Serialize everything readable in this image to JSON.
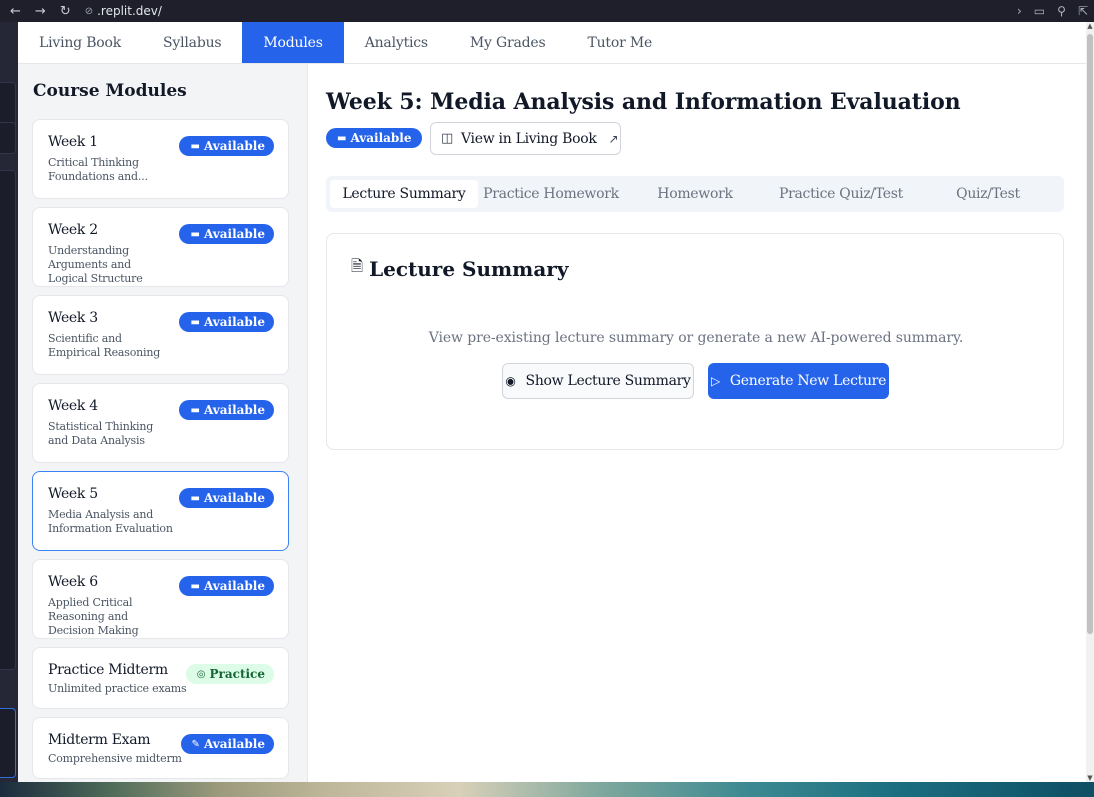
{
  "browser": {
    "back_icon": "←",
    "forward_icon": "→",
    "reload_icon": "↻",
    "url": ".replit.dev/"
  },
  "topnav": {
    "tabs": [
      {
        "label": "Living Book"
      },
      {
        "label": "Syllabus"
      },
      {
        "label": "Modules",
        "active": true
      },
      {
        "label": "Analytics"
      },
      {
        "label": "My Grades"
      },
      {
        "label": "Tutor Me"
      }
    ]
  },
  "sidebar": {
    "heading": "Course Modules",
    "modules": [
      {
        "title": "Week 1",
        "desc": "Critical Thinking Foundations and...",
        "badge": "Available",
        "badge_icon": "book-icon"
      },
      {
        "title": "Week 2",
        "desc": "Understanding Arguments and Logical Structure",
        "badge": "Available",
        "badge_icon": "book-icon"
      },
      {
        "title": "Week 3",
        "desc": "Scientific and Empirical Reasoning",
        "badge": "Available",
        "badge_icon": "book-icon"
      },
      {
        "title": "Week 4",
        "desc": "Statistical Thinking and Data Analysis",
        "badge": "Available",
        "badge_icon": "book-icon"
      },
      {
        "title": "Week 5",
        "desc": "Media Analysis and Information Evaluation",
        "badge": "Available",
        "badge_icon": "book-icon",
        "selected": true
      },
      {
        "title": "Week 6",
        "desc": "Applied Critical Reasoning and Decision Making",
        "badge": "Available",
        "badge_icon": "book-icon"
      },
      {
        "title": "Practice Midterm",
        "desc": "Unlimited practice exams",
        "badge": "Practice",
        "badge_icon": "target-icon"
      },
      {
        "title": "Midterm Exam",
        "desc": "Comprehensive midterm",
        "badge": "Available",
        "badge_icon": "memo-icon"
      }
    ]
  },
  "main": {
    "title": "Week 5: Media Analysis and Information Evaluation",
    "status_badge": "Available",
    "view_book_label": "View in Living Book",
    "subtabs": [
      {
        "label": "Lecture Summary",
        "active": true
      },
      {
        "label": "Practice Homework"
      },
      {
        "label": "Homework"
      },
      {
        "label": "Practice Quiz/Test"
      },
      {
        "label": "Quiz/Test"
      }
    ],
    "panel": {
      "title": "Lecture Summary",
      "description": "View pre-existing lecture summary or generate a new AI-powered summary.",
      "show_button": "Show Lecture Summary",
      "generate_button": "Generate New Lecture"
    }
  },
  "colors": {
    "accent": "#2563eb",
    "practice_bg": "#dcfce7",
    "practice_text": "#166534"
  }
}
